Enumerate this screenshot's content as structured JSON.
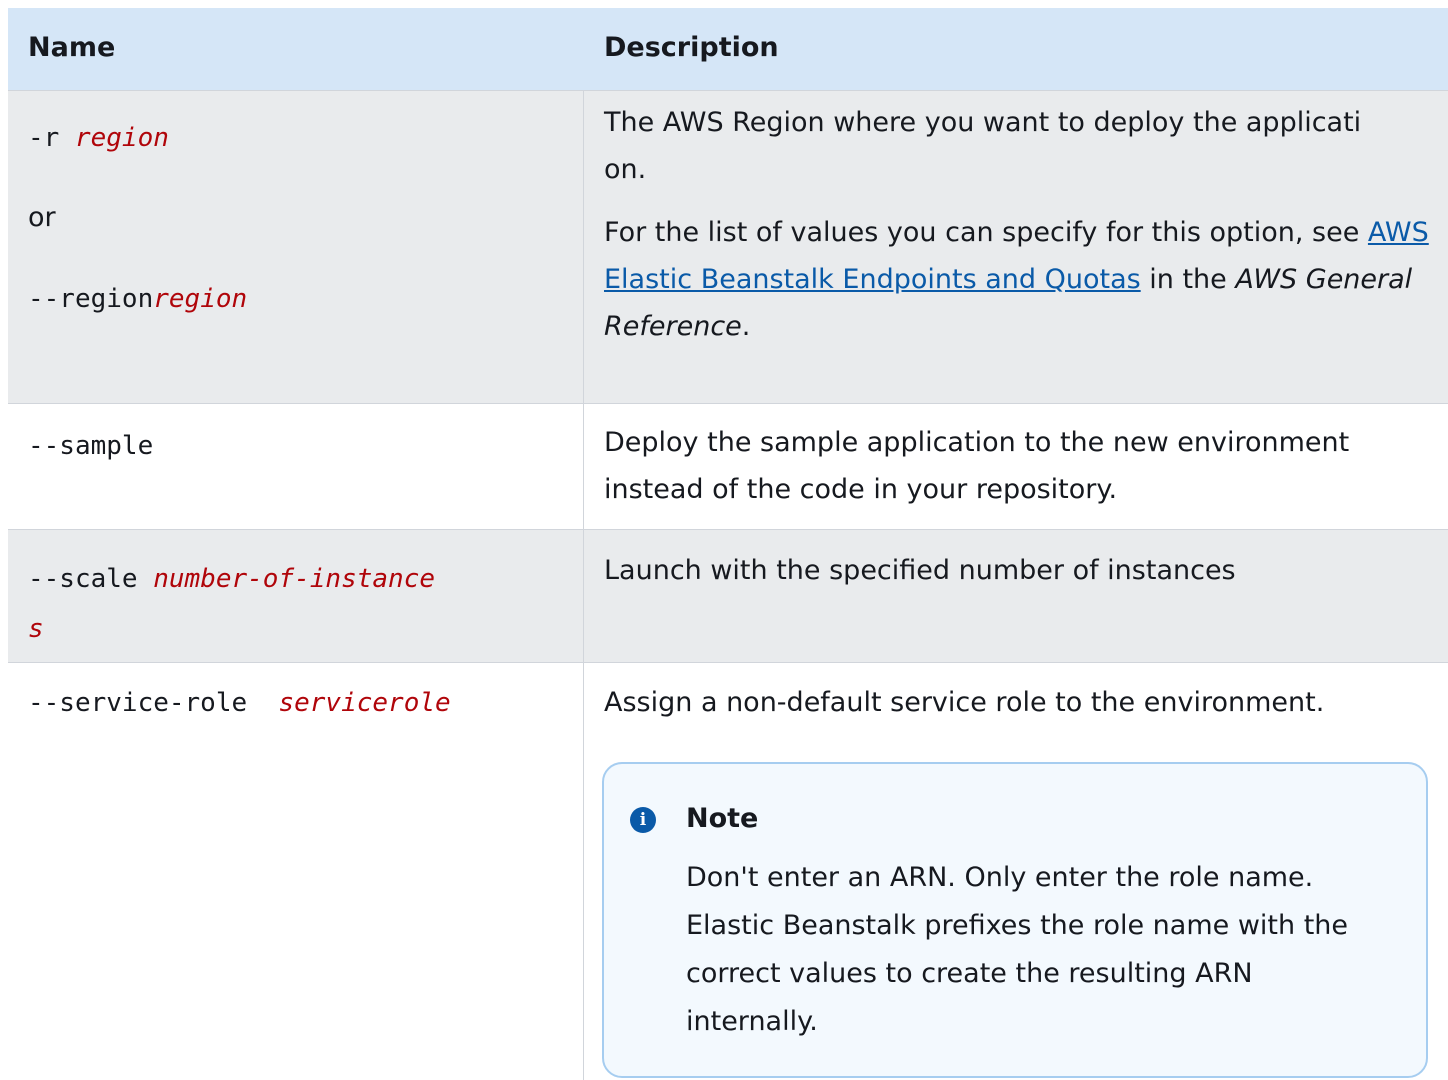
{
  "headers": {
    "name": "Name",
    "description": "Description"
  },
  "rows": [
    {
      "flag_short": "-r",
      "flag_short_param": "region",
      "or_text": "or",
      "flag_long": "--region",
      "flag_long_param": "region",
      "desc_line1": "The AWS Region where you want to deploy the applicati",
      "desc_line2": "on.",
      "desc2_prefix": "For the list of values you can specify for this option, see",
      "desc2_link": "AWS Elastic Beanstalk Endpoints and Quotas",
      "desc2_mid": " in the ",
      "desc2_em": "AWS General Reference",
      "desc2_suffix": "."
    },
    {
      "flag": "--sample",
      "desc": "Deploy the sample application to the new environment instead of the code in your repository."
    },
    {
      "flag": "--scale",
      "param_part1": "number-of-instance",
      "param_part2": "s",
      "desc": "Launch with the specified number of instances"
    },
    {
      "flag": "--service-role",
      "param": "servicerole",
      "desc": "Assign a non-default service role to the environment.",
      "note": {
        "icon": "info-icon",
        "title": "Note",
        "body": "Don't enter an ARN. Only enter the role name. Elastic Beanstalk prefixes the role name with the correct values to create the resulting ARN internally."
      }
    }
  ],
  "colors": {
    "header_bg": "#d5e6f7",
    "stripe_bg": "#e9ebed",
    "param": "#b0050a",
    "link": "#0a5aa8",
    "note_border": "#a6cdf0"
  }
}
